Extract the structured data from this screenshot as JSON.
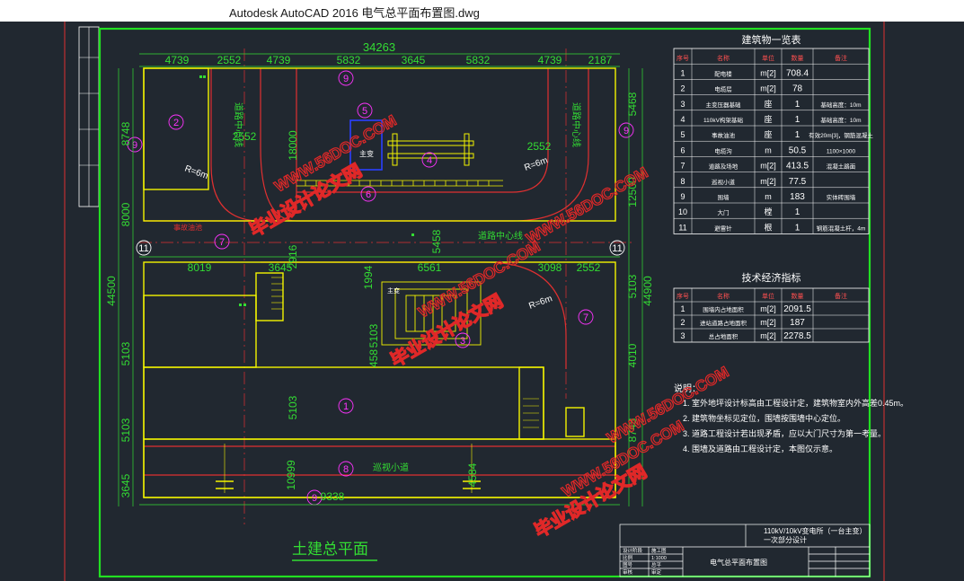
{
  "window": {
    "title": "Autodesk AutoCAD 2016     电气总平面布置图.dwg"
  },
  "colors": {
    "background": "#212830",
    "frame": "#22e022",
    "building": "#f4f400",
    "road": "#e03030",
    "dim": "#33dd33",
    "circle": "#ff33ff",
    "text": "#ffffff",
    "watermark": "#e02828"
  },
  "dims_top": [
    "4739",
    "2552",
    "4739",
    "5832",
    "3645",
    "5832",
    "4739",
    "2187"
  ],
  "dim_total": "34263",
  "dims_left": [
    "8748",
    "8000",
    "44500",
    "5103",
    "5103",
    "3645"
  ],
  "dims_right": [
    "5468",
    "12500",
    "44900",
    "5103",
    "4010",
    "8748"
  ],
  "dims_middle": [
    "8019",
    "3645",
    "1994",
    "6561",
    "3098",
    "2552",
    "2552",
    "18000",
    "2916",
    "5458",
    "5103",
    "458",
    "5103",
    "9338",
    "2552",
    "10999",
    "4584"
  ],
  "circles": [
    "9",
    "2",
    "5",
    "4",
    "6",
    "7",
    "11",
    "11",
    "3",
    "1",
    "8",
    "9",
    "9",
    "9",
    "7"
  ],
  "labels": {
    "road_center": "道路中心线",
    "road_center_v1": "道路中心线",
    "road_center_v2": "道路中心线",
    "radius1": "R=6m",
    "radius2": "R=6m",
    "radius3": "R=6m",
    "patrol_road": "巡视小道",
    "pool": "事故油池",
    "plan_title": "土建总平面",
    "main_transformer": "主变"
  },
  "table1": {
    "title": "建筑物一览表",
    "headers": [
      "序号",
      "名称",
      "单位",
      "数量",
      "备注"
    ],
    "rows": [
      [
        "1",
        "配电楼",
        "m[2]",
        "708.4",
        ""
      ],
      [
        "2",
        "电缆层",
        "m[2]",
        "78",
        ""
      ],
      [
        "3",
        "主变压器基础",
        "座",
        "1",
        "基础高度：10m"
      ],
      [
        "4",
        "110kV构架基础",
        "座",
        "1",
        "基础高度：10m"
      ],
      [
        "5",
        "事故油池",
        "座",
        "1",
        "有效20m[3]，钢筋混凝土"
      ],
      [
        "6",
        "电缆沟",
        "m",
        "50.5",
        "1100×1000"
      ],
      [
        "7",
        "道路及场地",
        "m[2]",
        "413.5",
        "混凝土路面"
      ],
      [
        "8",
        "巡视小道",
        "m[2]",
        "77.5",
        ""
      ],
      [
        "9",
        "围墙",
        "m",
        "183",
        "实体砖围墙"
      ],
      [
        "10",
        "大门",
        "樘",
        "1",
        ""
      ],
      [
        "11",
        "避雷针",
        "根",
        "1",
        "钢筋混凝土杆，4m"
      ]
    ]
  },
  "table2": {
    "title": "技术经济指标",
    "headers": [
      "序号",
      "名称",
      "单位",
      "数量",
      "备注"
    ],
    "rows": [
      [
        "1",
        "围墙内占地面积",
        "m[2]",
        "2091.5",
        ""
      ],
      [
        "2",
        "进站道路占地面积",
        "m[2]",
        "187",
        ""
      ],
      [
        "3",
        "总占地面积",
        "m[2]",
        "2278.5",
        ""
      ]
    ]
  },
  "notes": {
    "title": "说明：",
    "items": [
      "1.  室外地坪设计标高由工程设计定，建筑物室内外高差0.45m。",
      "2.  建筑物坐标见定位，围墙按围墙中心定位。",
      "3.  道路工程设计若出现矛盾，应以大门尺寸为第一考量。",
      "4.  围墙及道路由工程设计定，本图仅示意。"
    ]
  },
  "titleblock": {
    "project": "110kV/10kV变电所（一台主变）",
    "project2": "一次部分设计",
    "drawing": "电气总平面布置图",
    "rows_left": [
      "设计阶段",
      "比例",
      "图号",
      "审核"
    ],
    "rows_left_val": [
      "施工图",
      "1:1000",
      "总平",
      "审定"
    ]
  },
  "watermark": "毕业设计论文网",
  "watermark_url": "WWW.56DOC.COM"
}
